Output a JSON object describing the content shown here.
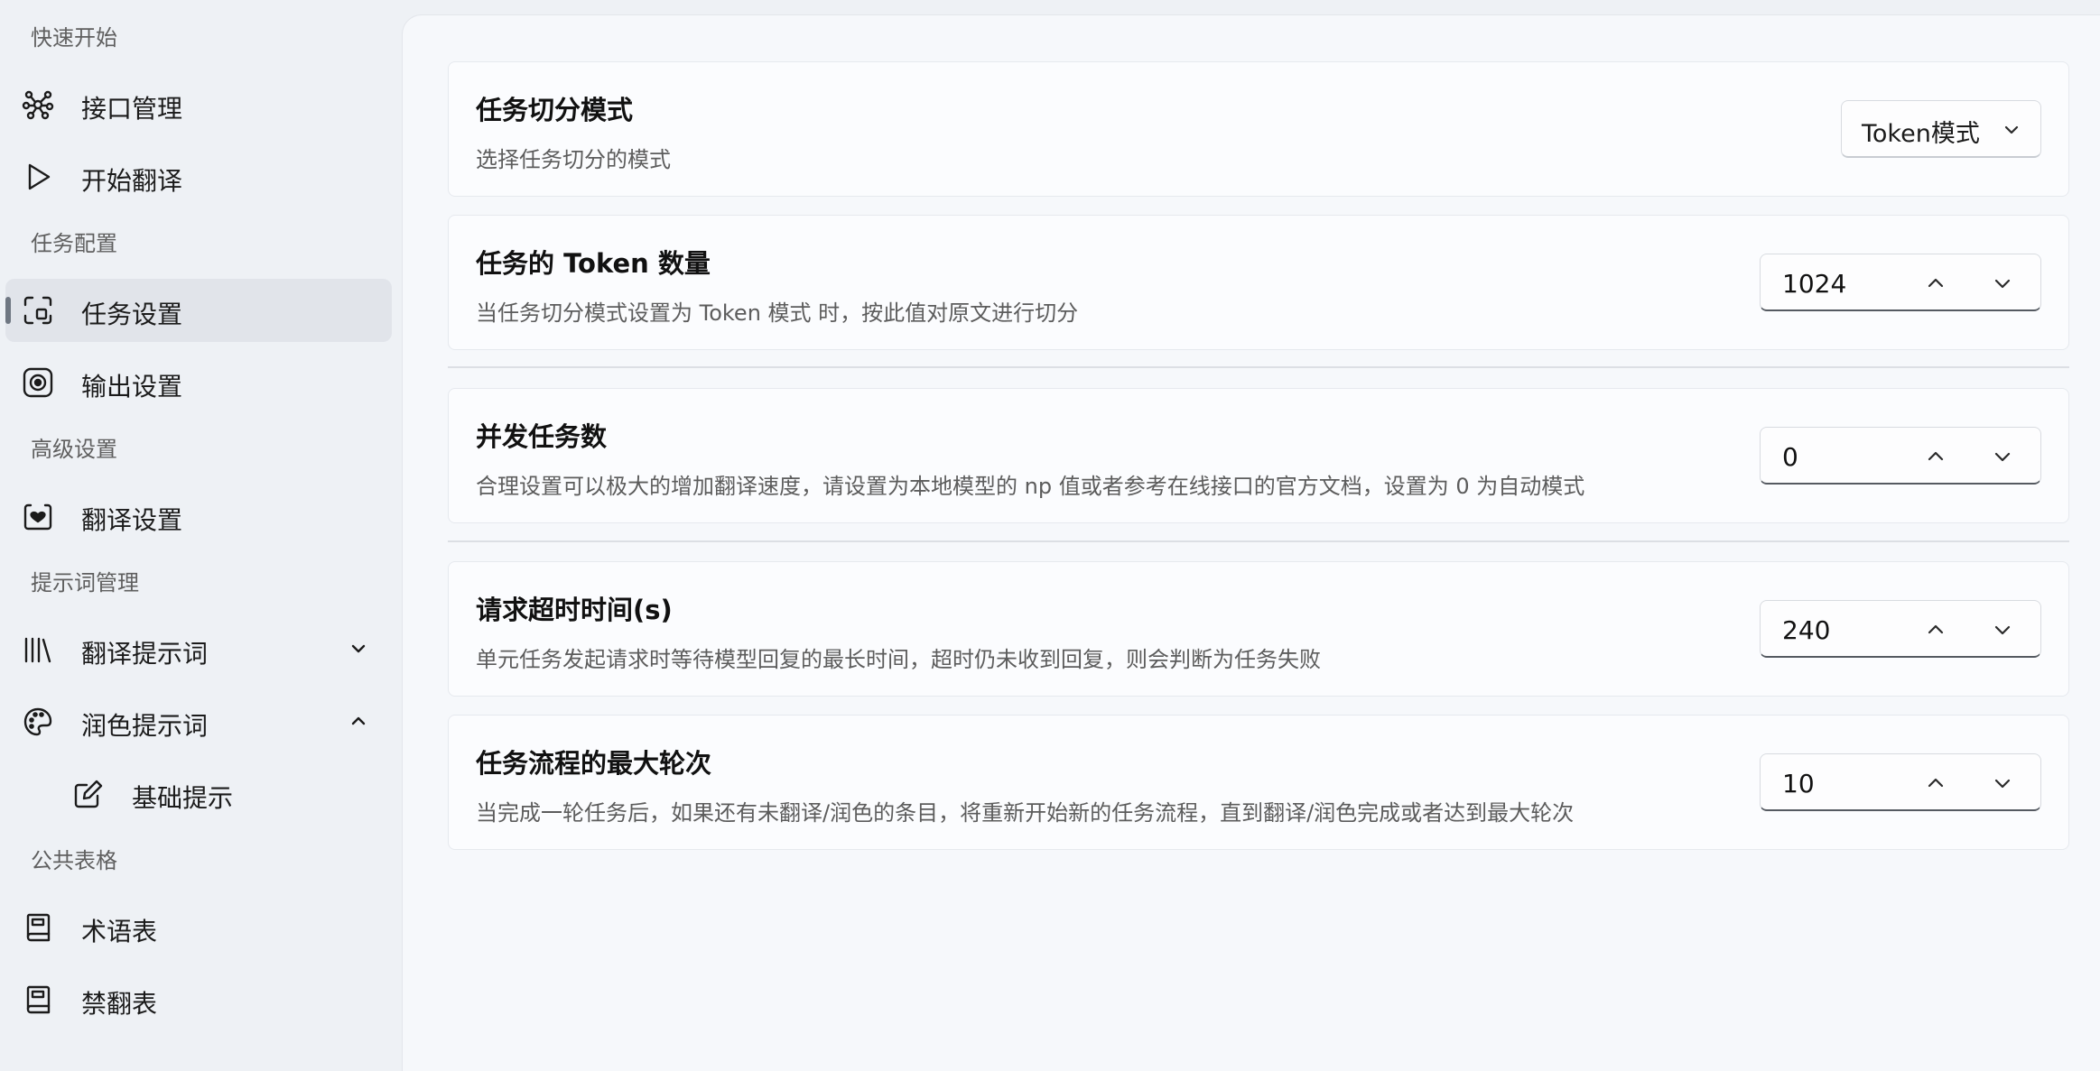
{
  "sidebar": {
    "sections": [
      {
        "label": "快速开始"
      },
      {
        "label": "任务配置"
      },
      {
        "label": "高级设置"
      },
      {
        "label": "提示词管理"
      },
      {
        "label": "公共表格"
      }
    ],
    "items": [
      {
        "label": "接口管理",
        "icon": "api-network-icon"
      },
      {
        "label": "开始翻译",
        "icon": "play-icon"
      },
      {
        "label": "任务设置",
        "icon": "task-frame-icon",
        "selected": true
      },
      {
        "label": "输出设置",
        "icon": "target-icon"
      },
      {
        "label": "翻译设置",
        "icon": "heart-calendar-icon"
      },
      {
        "label": "翻译提示词",
        "icon": "library-icon",
        "expanded": false
      },
      {
        "label": "润色提示词",
        "icon": "palette-icon",
        "expanded": true
      },
      {
        "label": "基础提示",
        "icon": "edit-icon"
      },
      {
        "label": "术语表",
        "icon": "book-icon"
      },
      {
        "label": "禁翻表",
        "icon": "book-icon"
      }
    ]
  },
  "settings": [
    {
      "title": "任务切分模式",
      "description": "选择任务切分的模式",
      "control": "dropdown",
      "value": "Token模式"
    },
    {
      "title": "任务的 Token 数量",
      "description": "当任务切分模式设置为 Token 模式 时，按此值对原文进行切分",
      "control": "spinbox",
      "value": "1024"
    },
    {
      "title": "并发任务数",
      "description": "合理设置可以极大的增加翻译速度，请设置为本地模型的 np 值或者参考在线接口的官方文档，设置为 0 为自动模式",
      "control": "spinbox",
      "value": "0"
    },
    {
      "title": "请求超时时间(s)",
      "description": "单元任务发起请求时等待模型回复的最长时间，超时仍未收到回复，则会判断为任务失败",
      "control": "spinbox",
      "value": "240"
    },
    {
      "title": "任务流程的最大轮次",
      "description": "当完成一轮任务后，如果还有未翻译/润色的条目，将重新开始新的任务流程，直到翻译/润色完成或者达到最大轮次",
      "control": "spinbox",
      "value": "10"
    }
  ],
  "colors": {
    "sidebar_bg": "#eef1f5",
    "main_bg": "#f6f8fb",
    "card_bg": "#fbfcfe",
    "selected_bg": "#e1e4ea",
    "accent_indicator": "#6f7782"
  }
}
